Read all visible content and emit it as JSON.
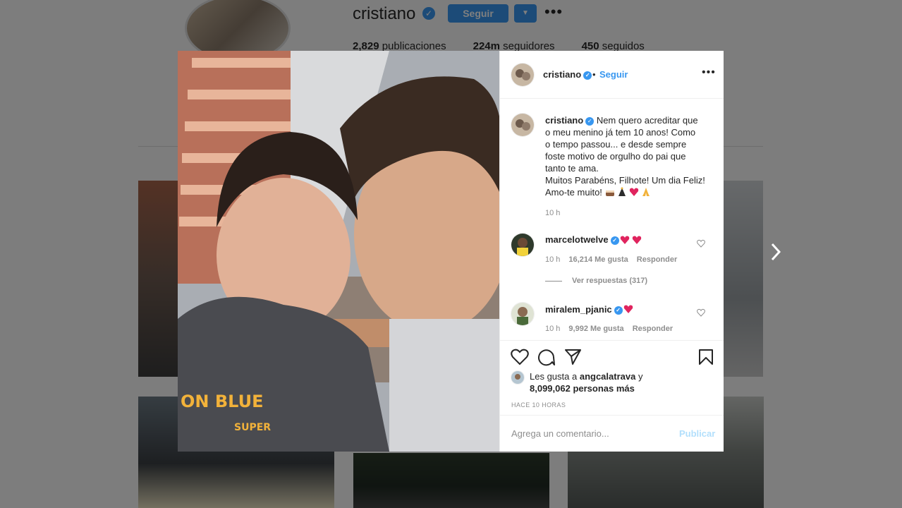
{
  "profile": {
    "username": "cristiano",
    "follow_label": "Seguir",
    "stats": [
      {
        "value": "2,829",
        "label": "publicaciones"
      },
      {
        "value": "224m",
        "label": "seguidores"
      },
      {
        "value": "450",
        "label": "seguidos"
      }
    ]
  },
  "post": {
    "author": "cristiano",
    "separator": "•",
    "follow_label": "Seguir",
    "caption_lines": [
      "Nem quero acreditar que",
      "o meu menino já tem 10 anos! Como",
      "o tempo passou... e desde sempre",
      "foste motivo de orgulho do pai que",
      "tanto te ama.",
      "Muitos Parabéns, Filhote! Um dia Feliz!",
      "Amo-te muito!"
    ],
    "caption_time": "10 h",
    "comments": [
      {
        "user": "marcelotwelve",
        "time": "10 h",
        "likes": "16,214 Me gusta",
        "reply": "Responder"
      },
      {
        "user": "miralem_pjanic",
        "time": "10 h",
        "likes": "9,992 Me gusta",
        "reply": "Responder"
      }
    ],
    "view_replies": "Ver respuestas (317)",
    "liked_by_prefix": "Les gusta a",
    "liked_by_user": "angcalatrava",
    "liked_by_suffix": "y",
    "likes_count": "8,099,062 personas más",
    "posted_ago": "HACE 10 HORAS",
    "comment_placeholder": "Agrega un comentario...",
    "publish_label": "Publicar"
  },
  "colors": {
    "accent": "#3897f0",
    "publish_disabled": "#b2dffc",
    "heart": "#e0245e"
  }
}
